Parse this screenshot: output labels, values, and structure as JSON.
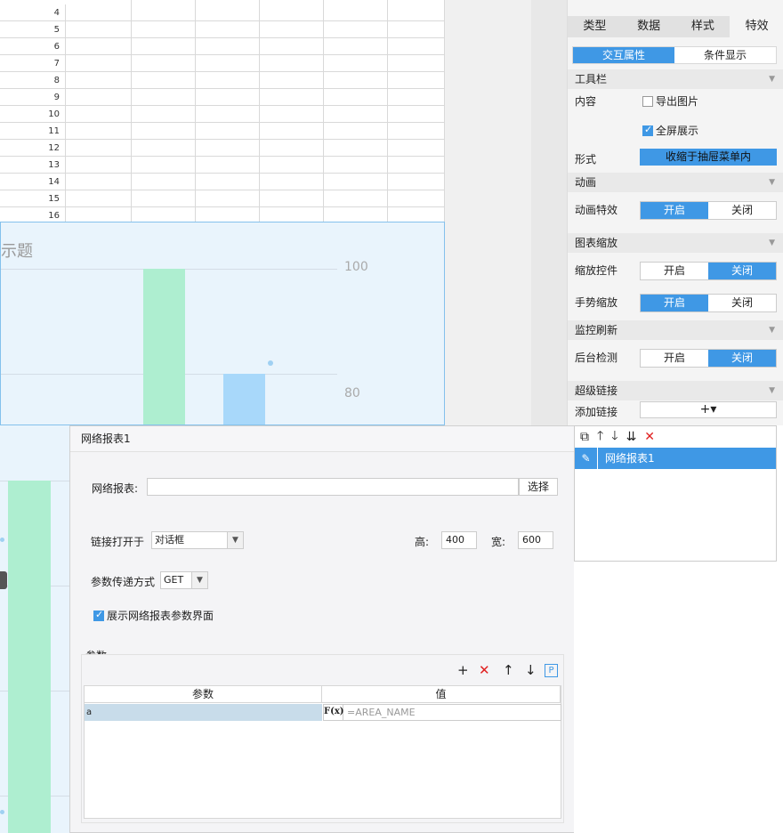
{
  "sheet": {
    "rows": [
      "4",
      "5",
      "6",
      "7",
      "8",
      "9",
      "10",
      "11",
      "12",
      "13",
      "14",
      "15",
      "16"
    ]
  },
  "chart": {
    "title_fragment": "示题",
    "ticks": [
      "100",
      "80"
    ]
  },
  "chart_data": {
    "type": "bar",
    "title": "示题",
    "ylim": [
      0,
      100
    ],
    "ytick_labels": [
      "100",
      "80"
    ],
    "series": [
      {
        "values": [
          100,
          80
        ]
      }
    ]
  },
  "panel": {
    "tabs": [
      "类型",
      "数据",
      "样式",
      "特效"
    ],
    "subtabs": [
      "交互属性",
      "条件显示"
    ],
    "toolbar": {
      "header": "工具栏",
      "content_label": "内容",
      "export_image": "导出图片",
      "fullscreen": "全屏展示",
      "form_label": "形式",
      "form_value": "收缩于抽屉菜单内"
    },
    "animation": {
      "header": "动画",
      "label": "动画特效",
      "on": "开启",
      "off": "关闭"
    },
    "zoom": {
      "header": "图表缩放",
      "control_label": "缩放控件",
      "gesture_label": "手势缩放",
      "on": "开启",
      "off": "关闭"
    },
    "monitor": {
      "header": "监控刷新",
      "label": "后台检测",
      "on": "开启",
      "off": "关闭"
    },
    "hyperlink": {
      "header": "超级链接",
      "add_label": "添加链接",
      "add_button": "+▾"
    }
  },
  "links": {
    "items": [
      "网络报表1"
    ]
  },
  "dialog": {
    "title": "网络报表1",
    "report_label": "网络报表:",
    "report_value": "",
    "select_button": "选择",
    "open_in_label": "链接打开于",
    "open_in_value": "对话框",
    "height_label": "高:",
    "height_value": "400",
    "width_label": "宽:",
    "width_value": "600",
    "param_method_label": "参数传递方式",
    "param_method_value": "GET",
    "show_params_label": "展示网络报表参数界面",
    "params": {
      "title": "参数",
      "col_param": "参数",
      "col_value": "值",
      "rows": [
        {
          "name": "a",
          "value": "=AREA_NAME"
        }
      ]
    }
  }
}
